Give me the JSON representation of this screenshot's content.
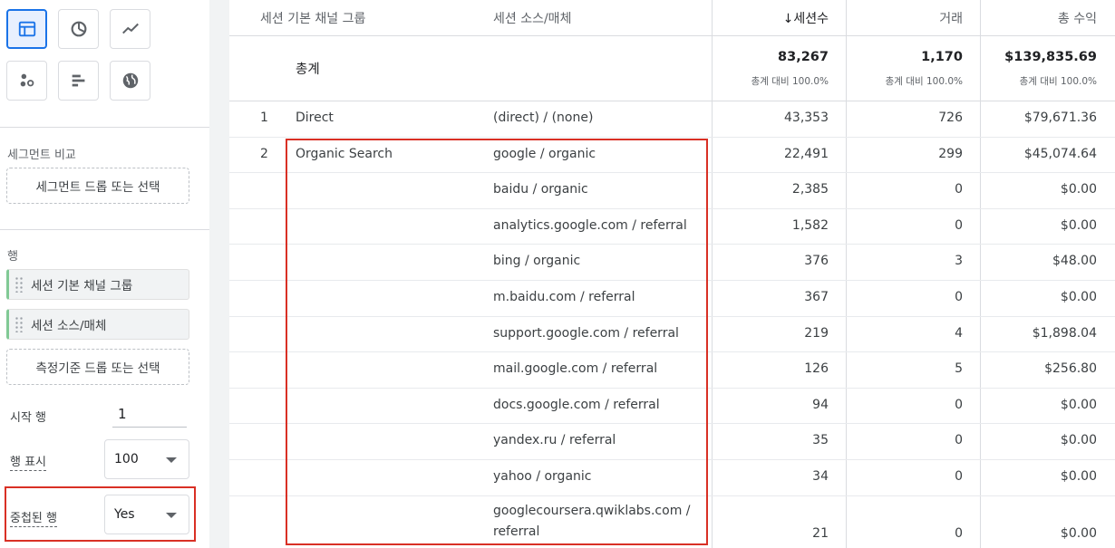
{
  "panel": {
    "segment_compare_label": "세그먼트 비교",
    "segment_drop_label": "세그먼트 드롭 또는 선택",
    "rows_label": "행",
    "row_dimensions": [
      "세션 기본 채널 그룹",
      "세션 소스/매체"
    ],
    "metric_drop_label": "측정기준 드롭 또는 선택",
    "start_row_label": "시작 행",
    "start_row_value": "1",
    "show_rows_label": "행 표시",
    "show_rows_value": "100",
    "nested_rows_label": "중첩된 행",
    "nested_rows_value": "Yes",
    "accent_color": "#1a73e8",
    "highlight_color": "#d93025"
  },
  "table": {
    "headers": {
      "channel": "세션 기본 채널 그룹",
      "source": "세션 소스/매체",
      "sessions": "↓세션수",
      "transactions": "거래",
      "revenue": "총 수익"
    },
    "totals": {
      "label": "총계",
      "sessions": "83,267",
      "transactions": "1,170",
      "revenue": "$139,835.69",
      "sessions_pct": "총계 대비 100.0%",
      "transactions_pct": "총계 대비 100.0%",
      "revenue_pct": "총계 대비 100.0%"
    },
    "rows": [
      {
        "idx": "1",
        "channel": "Direct",
        "source": "(direct) / (none)",
        "sessions": "43,353",
        "transactions": "726",
        "revenue": "$79,671.36"
      },
      {
        "idx": "2",
        "channel": "Organic Search",
        "source": "google / organic",
        "sessions": "22,491",
        "transactions": "299",
        "revenue": "$45,074.64"
      },
      {
        "idx": "",
        "channel": "",
        "source": "baidu / organic",
        "sessions": "2,385",
        "transactions": "0",
        "revenue": "$0.00"
      },
      {
        "idx": "",
        "channel": "",
        "source": "analytics.google.com / referral",
        "sessions": "1,582",
        "transactions": "0",
        "revenue": "$0.00"
      },
      {
        "idx": "",
        "channel": "",
        "source": "bing / organic",
        "sessions": "376",
        "transactions": "3",
        "revenue": "$48.00"
      },
      {
        "idx": "",
        "channel": "",
        "source": "m.baidu.com / referral",
        "sessions": "367",
        "transactions": "0",
        "revenue": "$0.00"
      },
      {
        "idx": "",
        "channel": "",
        "source": "support.google.com / referral",
        "sessions": "219",
        "transactions": "4",
        "revenue": "$1,898.04"
      },
      {
        "idx": "",
        "channel": "",
        "source": "mail.google.com / referral",
        "sessions": "126",
        "transactions": "5",
        "revenue": "$256.80"
      },
      {
        "idx": "",
        "channel": "",
        "source": "docs.google.com / referral",
        "sessions": "94",
        "transactions": "0",
        "revenue": "$0.00"
      },
      {
        "idx": "",
        "channel": "",
        "source": "yandex.ru / referral",
        "sessions": "35",
        "transactions": "0",
        "revenue": "$0.00"
      },
      {
        "idx": "",
        "channel": "",
        "source": "yahoo / organic",
        "sessions": "34",
        "transactions": "0",
        "revenue": "$0.00"
      }
    ],
    "last_row": {
      "source_line1": "googlecoursera.qwiklabs.com /",
      "source_line2": "referral",
      "sessions": "21",
      "transactions": "0",
      "revenue": "$0.00"
    }
  },
  "icons": [
    "table-icon",
    "donut-chart-icon",
    "line-chart-icon",
    "scatter-icon",
    "bar-chart-icon",
    "globe-icon"
  ]
}
